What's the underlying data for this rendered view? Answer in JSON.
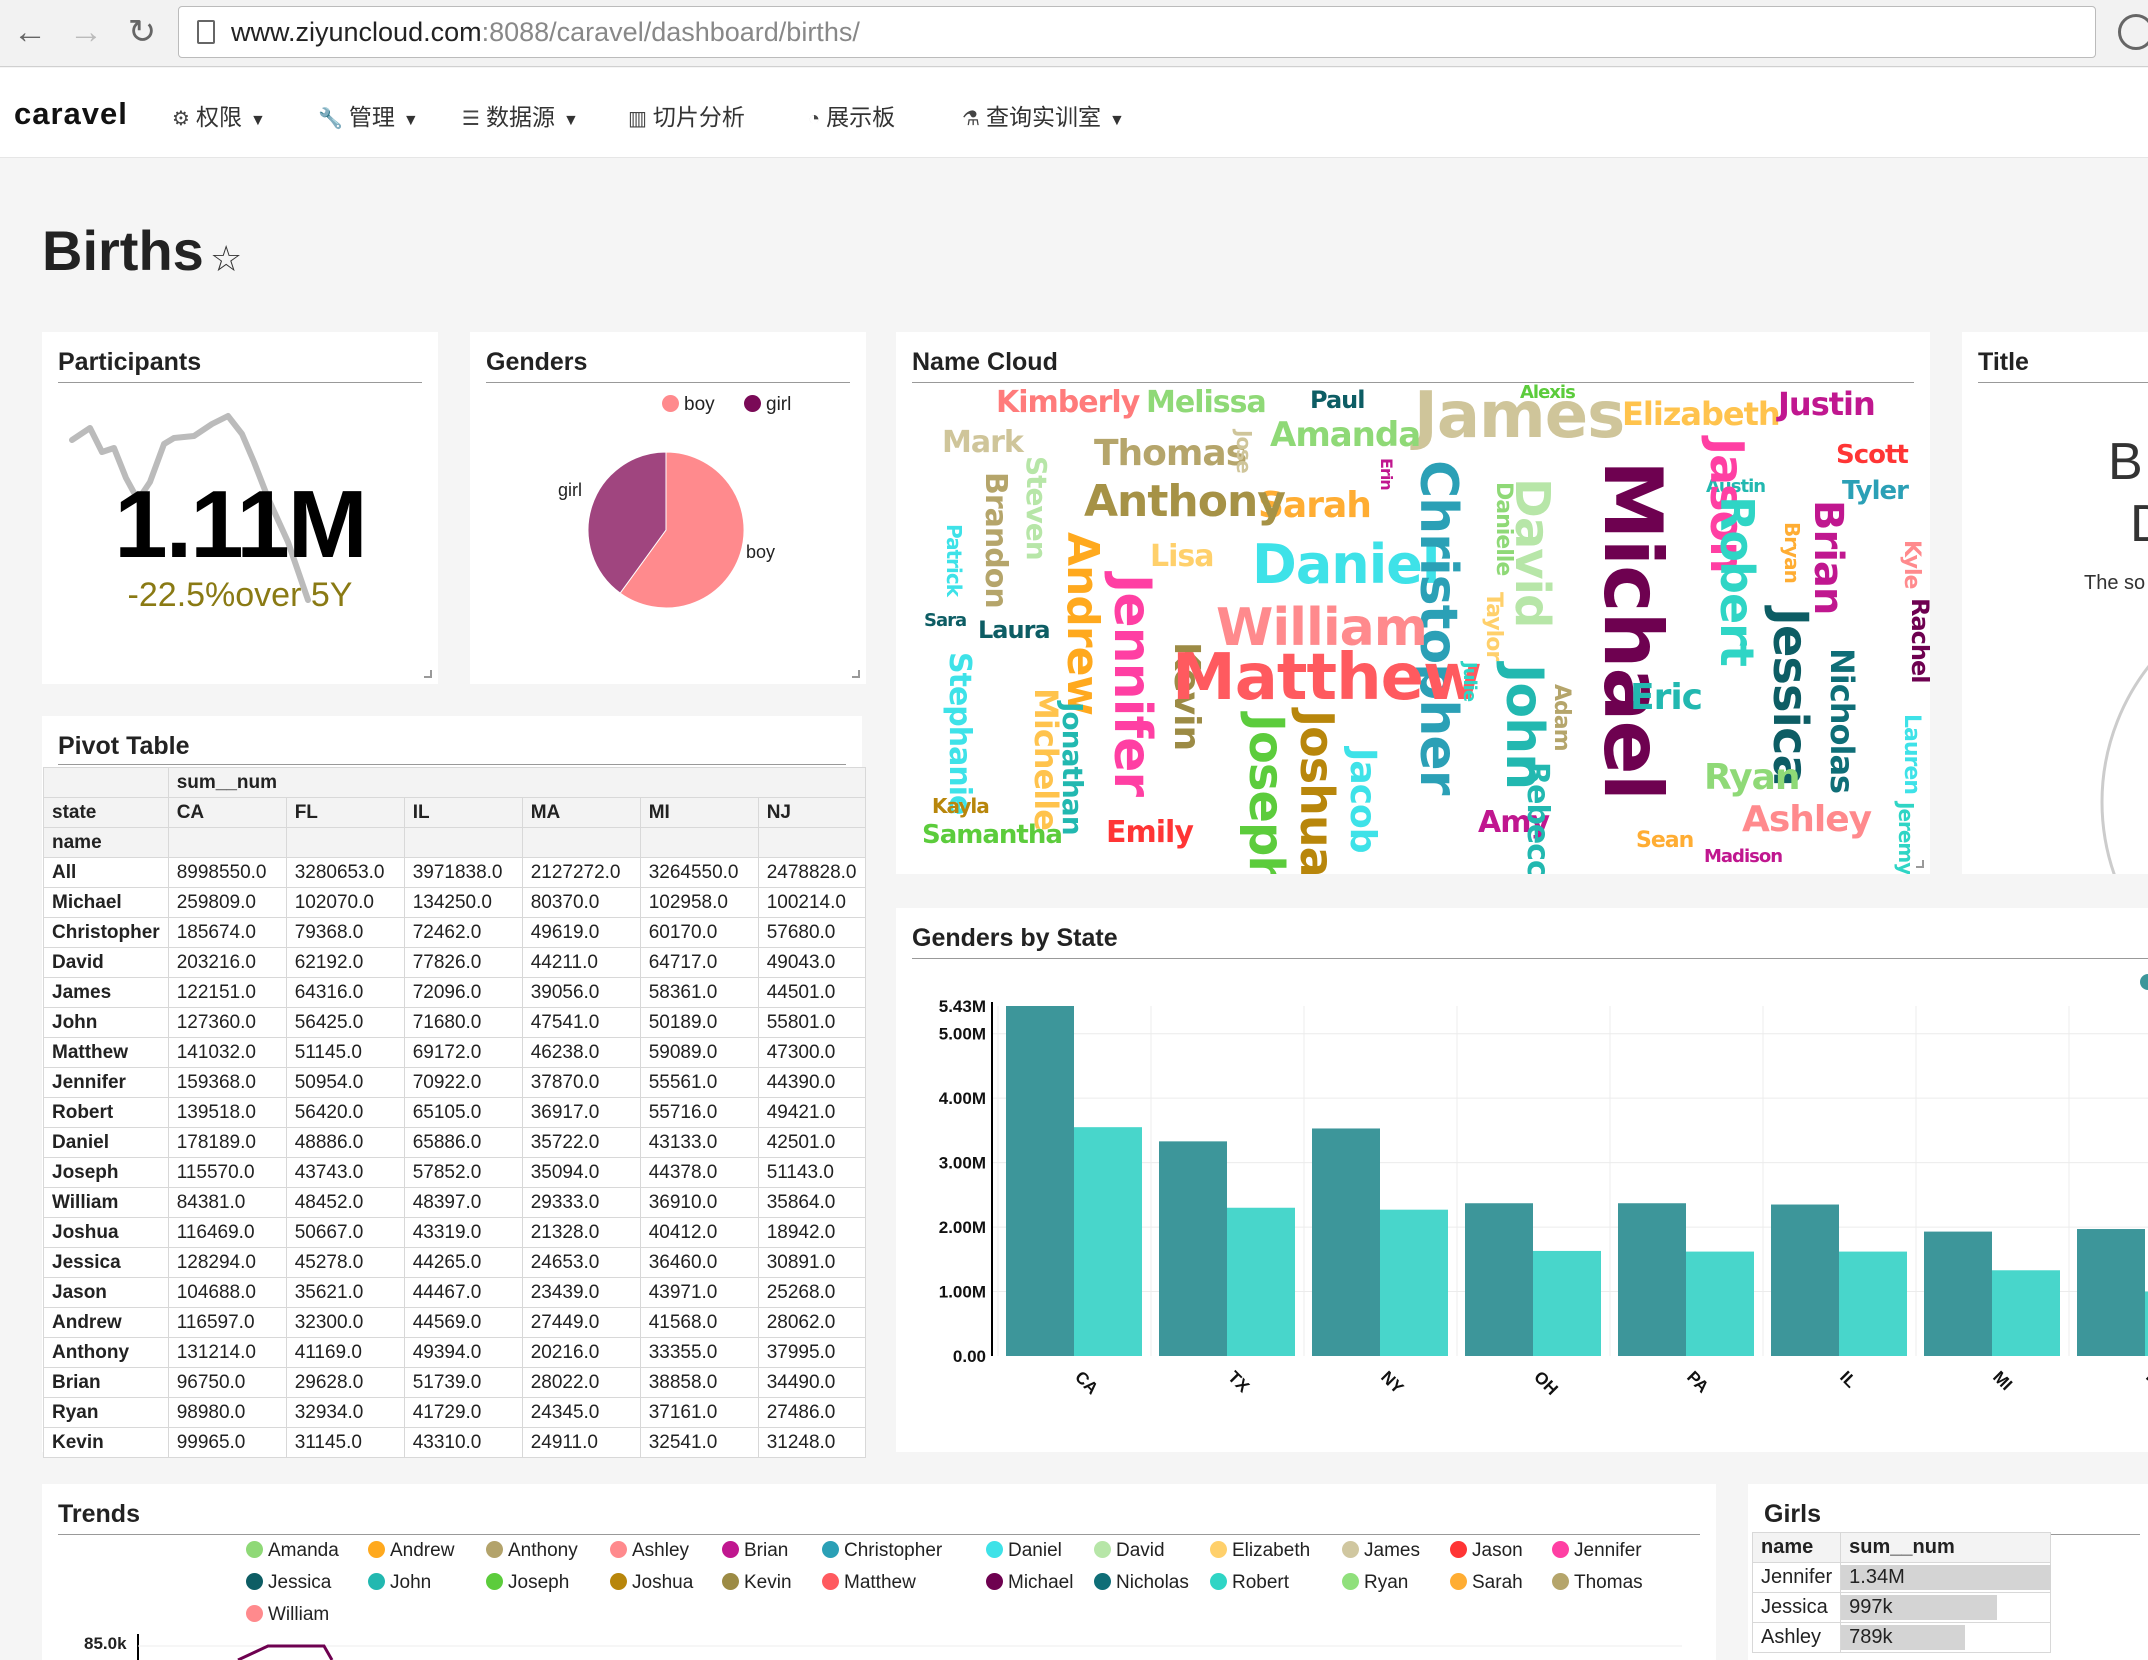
{
  "browser": {
    "url_host": "www.ziyuncloud.com",
    "url_rest": ":8088/caravel/dashboard/births/"
  },
  "app": {
    "brand": "caravel",
    "menu": [
      {
        "label": "权限",
        "icon": "gears-icon",
        "dropdown": true
      },
      {
        "label": "管理",
        "icon": "wrench-icon",
        "dropdown": true
      },
      {
        "label": "数据源",
        "icon": "database-icon",
        "dropdown": true
      },
      {
        "label": "切片分析",
        "icon": "bar-chart-icon",
        "dropdown": false
      },
      {
        "label": "展示板",
        "icon": "dashboard-icon",
        "dropdown": false
      },
      {
        "label": "查询实训室",
        "icon": "flask-icon",
        "dropdown": true
      }
    ]
  },
  "page": {
    "title": "Births"
  },
  "panels": {
    "participants": {
      "title": "Participants",
      "value": "1.11M",
      "change": "-22.5%over 5Y"
    },
    "genders": {
      "title": "Genders"
    },
    "name_cloud": {
      "title": "Name Cloud"
    },
    "title_panel": {
      "title": "Title",
      "text1": "B",
      "text2": "D",
      "text3": "The so"
    },
    "pivot": {
      "title": "Pivot Table"
    },
    "genders_by_state": {
      "title": "Genders by State"
    },
    "trends": {
      "title": "Trends",
      "ytick": "85.0k"
    },
    "girls": {
      "title": "Girls"
    }
  },
  "colors": {
    "accent": "#3e9a9e",
    "boy": "#ff8a8d",
    "girl": "#7a0a57",
    "series_dark": "#3d969a",
    "series_light": "#48d6cb"
  },
  "genders_pie": {
    "type": "pie",
    "legend": [
      {
        "name": "boy",
        "color": "#ff8a8d"
      },
      {
        "name": "girl",
        "color": "#7a0a57"
      }
    ],
    "slices": [
      {
        "name": "boy",
        "value": 0.6
      },
      {
        "name": "girl",
        "value": 0.4
      }
    ],
    "legend_position": "top-right"
  },
  "pivot_table": {
    "header_value": "sum__num",
    "col_label": "state",
    "row_label": "name",
    "columns": [
      "CA",
      "FL",
      "IL",
      "MA",
      "MI",
      "NJ"
    ],
    "rows": [
      {
        "name": "All",
        "values": [
          "8998550.0",
          "3280653.0",
          "3971838.0",
          "2127272.0",
          "3264550.0",
          "2478828.0"
        ]
      },
      {
        "name": "Michael",
        "values": [
          "259809.0",
          "102070.0",
          "134250.0",
          "80370.0",
          "102958.0",
          "100214.0"
        ]
      },
      {
        "name": "Christopher",
        "values": [
          "185674.0",
          "79368.0",
          "72462.0",
          "49619.0",
          "60170.0",
          "57680.0"
        ]
      },
      {
        "name": "David",
        "values": [
          "203216.0",
          "62192.0",
          "77826.0",
          "44211.0",
          "64717.0",
          "49043.0"
        ]
      },
      {
        "name": "James",
        "values": [
          "122151.0",
          "64316.0",
          "72096.0",
          "39056.0",
          "58361.0",
          "44501.0"
        ]
      },
      {
        "name": "John",
        "values": [
          "127360.0",
          "56425.0",
          "71680.0",
          "47541.0",
          "50189.0",
          "55801.0"
        ]
      },
      {
        "name": "Matthew",
        "values": [
          "141032.0",
          "51145.0",
          "69172.0",
          "46238.0",
          "59089.0",
          "47300.0"
        ]
      },
      {
        "name": "Jennifer",
        "values": [
          "159368.0",
          "50954.0",
          "70922.0",
          "37870.0",
          "55561.0",
          "44390.0"
        ]
      },
      {
        "name": "Robert",
        "values": [
          "139518.0",
          "56420.0",
          "65105.0",
          "36917.0",
          "55716.0",
          "49421.0"
        ]
      },
      {
        "name": "Daniel",
        "values": [
          "178189.0",
          "48886.0",
          "65886.0",
          "35722.0",
          "43133.0",
          "42501.0"
        ]
      },
      {
        "name": "Joseph",
        "values": [
          "115570.0",
          "43743.0",
          "57852.0",
          "35094.0",
          "44378.0",
          "51143.0"
        ]
      },
      {
        "name": "William",
        "values": [
          "84381.0",
          "48452.0",
          "48397.0",
          "29333.0",
          "36910.0",
          "35864.0"
        ]
      },
      {
        "name": "Joshua",
        "values": [
          "116469.0",
          "50667.0",
          "43319.0",
          "21328.0",
          "40412.0",
          "18942.0"
        ]
      },
      {
        "name": "Jessica",
        "values": [
          "128294.0",
          "45278.0",
          "44265.0",
          "24653.0",
          "36460.0",
          "30891.0"
        ]
      },
      {
        "name": "Jason",
        "values": [
          "104688.0",
          "35621.0",
          "44467.0",
          "23439.0",
          "43971.0",
          "25268.0"
        ]
      },
      {
        "name": "Andrew",
        "values": [
          "116597.0",
          "32300.0",
          "44569.0",
          "27449.0",
          "41568.0",
          "28062.0"
        ]
      },
      {
        "name": "Anthony",
        "values": [
          "131214.0",
          "41169.0",
          "49394.0",
          "20216.0",
          "33355.0",
          "37995.0"
        ]
      },
      {
        "name": "Brian",
        "values": [
          "96750.0",
          "29628.0",
          "51739.0",
          "28022.0",
          "38858.0",
          "34490.0"
        ]
      },
      {
        "name": "Ryan",
        "values": [
          "98980.0",
          "32934.0",
          "41729.0",
          "24345.0",
          "37161.0",
          "27486.0"
        ]
      },
      {
        "name": "Kevin",
        "values": [
          "99965.0",
          "31145.0",
          "43310.0",
          "24911.0",
          "32541.0",
          "31248.0"
        ]
      }
    ]
  },
  "chart_data": {
    "type": "bar",
    "categories": [
      "CA",
      "TX",
      "NY",
      "OH",
      "PA",
      "IL",
      "MI",
      "FL"
    ],
    "series": [
      {
        "values": [
          5430000,
          3550000,
          3330000,
          3530000,
          2370000,
          2280000,
          2370000,
          1630000
        ]
      },
      {
        "values": [
          3550000,
          2300000,
          2270000,
          1630000,
          1620000,
          1620000,
          1330000,
          1000000
        ]
      }
    ],
    "interleaved_note": "",
    "ytick_labels": [
      "0.00",
      "1.00M",
      "2.00M",
      "3.00M",
      "4.00M",
      "5.00M",
      "5.43M"
    ],
    "ylim": [
      0,
      5430000
    ],
    "grid": true
  },
  "bar_pairs": [
    [
      5430000,
      3550000
    ],
    [
      3330000,
      2300000
    ],
    [
      3530000,
      2270000
    ],
    [
      2370000,
      1630000
    ],
    [
      2370000,
      1620000
    ],
    [
      2350000,
      1620000
    ],
    [
      1930000,
      1330000
    ],
    [
      1970000,
      1000000
    ]
  ],
  "trends_legend": [
    {
      "name": "Amanda",
      "color": "#8fd977"
    },
    {
      "name": "Andrew",
      "color": "#ffa91e"
    },
    {
      "name": "Anthony",
      "color": "#b3a36b"
    },
    {
      "name": "Ashley",
      "color": "#ff8a8d"
    },
    {
      "name": "Brian",
      "color": "#c0178f"
    },
    {
      "name": "Christopher",
      "color": "#2ba0b6"
    },
    {
      "name": "Daniel",
      "color": "#3ee2e8"
    },
    {
      "name": "David",
      "color": "#b7e6a8"
    },
    {
      "name": "Elizabeth",
      "color": "#ffd06b"
    },
    {
      "name": "James",
      "color": "#d0c7a0"
    },
    {
      "name": "Jason",
      "color": "#ff3535"
    },
    {
      "name": "Jennifer",
      "color": "#ff3fa3"
    },
    {
      "name": "Jessica",
      "color": "#0d5d64"
    },
    {
      "name": "John",
      "color": "#22b8b0"
    },
    {
      "name": "Joseph",
      "color": "#5ccc3c"
    },
    {
      "name": "Joshua",
      "color": "#b8860b"
    },
    {
      "name": "Kevin",
      "color": "#9c8b45"
    },
    {
      "name": "Matthew",
      "color": "#ff5a5f"
    },
    {
      "name": "Michael",
      "color": "#6e0150"
    },
    {
      "name": "Nicholas",
      "color": "#0f6e77"
    },
    {
      "name": "Robert",
      "color": "#2fd5c5"
    },
    {
      "name": "Ryan",
      "color": "#90e07c"
    },
    {
      "name": "Sarah",
      "color": "#ffad33"
    },
    {
      "name": "Thomas",
      "color": "#b5a56b"
    },
    {
      "name": "William",
      "color": "#ff8a8d"
    }
  ],
  "girls_table": {
    "headers": [
      "name",
      "sum__num"
    ],
    "rows": [
      {
        "name": "Jennifer",
        "value": "1.34M",
        "fraction": 1.0
      },
      {
        "name": "Jessica",
        "value": "997k",
        "fraction": 0.744
      },
      {
        "name": "Ashley",
        "value": "789k",
        "fraction": 0.589
      }
    ]
  },
  "name_cloud_words": [
    {
      "text": "Kimberly",
      "color": "#ff7b7b"
    },
    {
      "text": "Melissa",
      "color": "#8fd977"
    },
    {
      "text": "Paul",
      "color": "#0d5d64"
    },
    {
      "text": "James",
      "color": "#cfc59a"
    },
    {
      "text": "Alexis",
      "color": "#5ccc3c"
    },
    {
      "text": "Elizabeth",
      "color": "#ffc34d"
    },
    {
      "text": "Justin",
      "color": "#c0178f"
    },
    {
      "text": "Mark",
      "color": "#cfc59a"
    },
    {
      "text": "Thomas",
      "color": "#b5a56b"
    },
    {
      "text": "Amanda",
      "color": "#8fd977"
    },
    {
      "text": "Scott",
      "color": "#ff3535"
    },
    {
      "text": "Austin",
      "color": "#22b8b0"
    },
    {
      "text": "Tyler",
      "color": "#2ba0b6"
    },
    {
      "text": "Steven",
      "color": "#b7e6a8"
    },
    {
      "text": "Jose",
      "color": "#cfc59a"
    },
    {
      "text": "Sarah",
      "color": "#ffad33"
    },
    {
      "text": "Erin",
      "color": "#c0178f"
    },
    {
      "text": "Brandon",
      "color": "#b5a56b"
    },
    {
      "text": "Anthony",
      "color": "#a69246"
    },
    {
      "text": "Daniel",
      "color": "#3ee2e8"
    },
    {
      "text": "Christopher",
      "color": "#2ba0b6"
    },
    {
      "text": "Danielle",
      "color": "#8fd977"
    },
    {
      "text": "David",
      "color": "#b7e6a8"
    },
    {
      "text": "Michael",
      "color": "#6e0150"
    },
    {
      "text": "Jason",
      "color": "#ff3fa3"
    },
    {
      "text": "Robert",
      "color": "#2fd5c5"
    },
    {
      "text": "Bryan",
      "color": "#ffad33"
    },
    {
      "text": "Brian",
      "color": "#c0178f"
    },
    {
      "text": "Kyle",
      "color": "#ff8a8d"
    },
    {
      "text": "Patrick",
      "color": "#3ee2e8"
    },
    {
      "text": "Andrew",
      "color": "#ffa91e"
    },
    {
      "text": "Lisa",
      "color": "#ffd06b"
    },
    {
      "text": "William",
      "color": "#ff8a8d"
    },
    {
      "text": "Rachel",
      "color": "#6e0150"
    },
    {
      "text": "Sara",
      "color": "#0d5d64"
    },
    {
      "text": "Laura",
      "color": "#0d5d64"
    },
    {
      "text": "Taylor",
      "color": "#ffd06b"
    },
    {
      "text": "Jessica",
      "color": "#0d5d64"
    },
    {
      "text": "Nicholas",
      "color": "#0f6e77"
    },
    {
      "text": "Stephanie",
      "color": "#3ee2e8"
    },
    {
      "text": "Michelle",
      "color": "#ffc34d"
    },
    {
      "text": "Jonathan",
      "color": "#22b8b0"
    },
    {
      "text": "Jennifer",
      "color": "#ff3fa3"
    },
    {
      "text": "Kevin",
      "color": "#9c8b45"
    },
    {
      "text": "Matthew",
      "color": "#ff5a5f"
    },
    {
      "text": "Julie",
      "color": "#2fd5c5"
    },
    {
      "text": "John",
      "color": "#22b8b0"
    },
    {
      "text": "Adam",
      "color": "#b5a56b"
    },
    {
      "text": "Eric",
      "color": "#22b8b0"
    },
    {
      "text": "Lauren",
      "color": "#3ee2e8"
    },
    {
      "text": "Joseph",
      "color": "#5ccc3c"
    },
    {
      "text": "Joshua",
      "color": "#b8860b"
    },
    {
      "text": "Jacob",
      "color": "#3ee2e8"
    },
    {
      "text": "Ryan",
      "color": "#8fd977"
    },
    {
      "text": "Kayla",
      "color": "#b8860b"
    },
    {
      "text": "Samantha",
      "color": "#5ccc3c"
    },
    {
      "text": "Emily",
      "color": "#ff3535"
    },
    {
      "text": "Amy",
      "color": "#c0178f"
    },
    {
      "text": "Rebecca",
      "color": "#22b8b0"
    },
    {
      "text": "Sean",
      "color": "#ffad33"
    },
    {
      "text": "Madison",
      "color": "#c0178f"
    },
    {
      "text": "Ashley",
      "color": "#ff8a8d"
    },
    {
      "text": "Jeremy",
      "color": "#2fd5c5"
    }
  ]
}
